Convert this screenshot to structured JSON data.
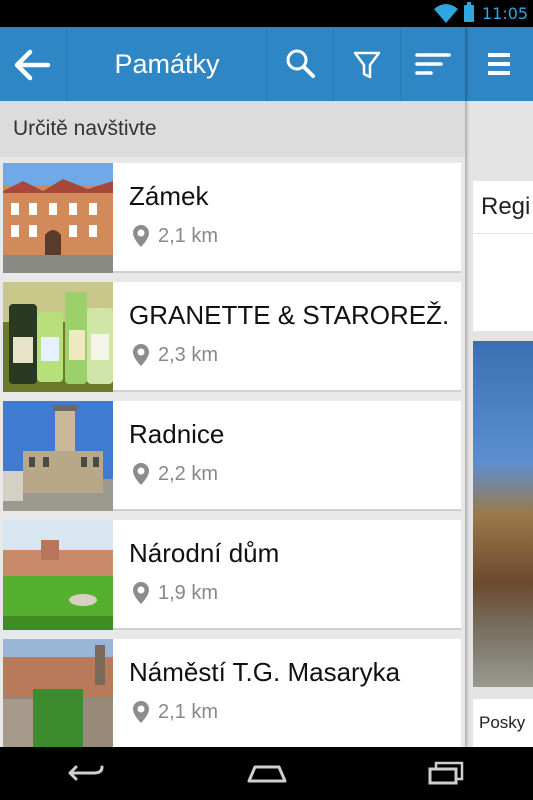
{
  "status_bar": {
    "time": "11:05",
    "icons": [
      "wifi-icon",
      "battery-icon"
    ]
  },
  "app_bar": {
    "title": "Památky",
    "back_icon": "arrow-left-icon",
    "actions": [
      "search-icon",
      "filter-icon",
      "sort-icon"
    ],
    "drawer_icon": "menu-icon"
  },
  "section": {
    "title": "Určitě navštivte"
  },
  "items": [
    {
      "name": "Zámek",
      "distance": "2,1 km"
    },
    {
      "name": "GRANETTE & STAROREŽ.",
      "distance": "2,3 km"
    },
    {
      "name": "Radnice",
      "distance": "2,2 km"
    },
    {
      "name": "Národní dům",
      "distance": "1,9 km"
    },
    {
      "name": "Náměstí T.G. Masaryka",
      "distance": "2,1 km"
    }
  ],
  "drawer": {
    "card_title": "Regi",
    "footer_text": "Posky"
  },
  "colors": {
    "app_bar": "#2f86c5",
    "status_accent": "#2fa6e0",
    "background": "#e8e8e8"
  },
  "nav_bar": {
    "buttons": [
      "back-icon",
      "home-icon",
      "recents-icon"
    ]
  }
}
